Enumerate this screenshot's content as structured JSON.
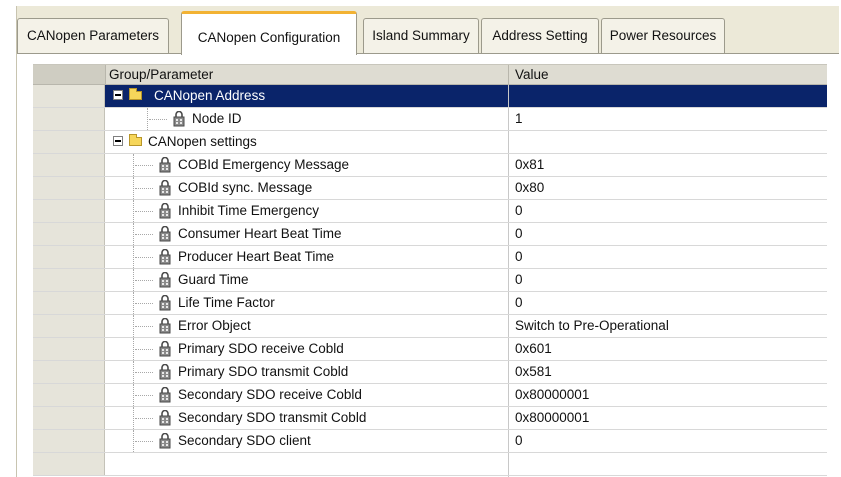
{
  "tabs": [
    {
      "label": "CANopen Parameters",
      "active": false
    },
    {
      "label": "CANopen Configuration",
      "active": true
    },
    {
      "label": "Island Summary",
      "active": false
    },
    {
      "label": "Address Setting",
      "active": false
    },
    {
      "label": "Power Resources",
      "active": false
    }
  ],
  "table": {
    "headers": {
      "param": "Group/Parameter",
      "value": "Value"
    },
    "groups": [
      {
        "label": "CANopen Address",
        "selected": true,
        "icon": "folder-icon",
        "params": [
          {
            "label": "Node ID",
            "value": "1"
          }
        ]
      },
      {
        "label": "CANopen settings",
        "selected": false,
        "icon": "folder-icon",
        "params": [
          {
            "label": "COBId Emergency Message",
            "value": "0x81"
          },
          {
            "label": "COBId sync. Message",
            "value": "0x80"
          },
          {
            "label": "Inhibit Time Emergency",
            "value": "0"
          },
          {
            "label": "Consumer Heart Beat Time",
            "value": "0"
          },
          {
            "label": "Producer Heart Beat Time",
            "value": "0"
          },
          {
            "label": "Guard Time",
            "value": "0"
          },
          {
            "label": "Life Time Factor",
            "value": "0"
          },
          {
            "label": "Error Object",
            "value": "Switch to Pre-Operational"
          },
          {
            "label": "Primary SDO receive Cobld",
            "value": "0x601"
          },
          {
            "label": "Primary SDO transmit Cobld",
            "value": "0x581"
          },
          {
            "label": "Secondary SDO receive Cobld",
            "value": "0x80000001"
          },
          {
            "label": "Secondary SDO transmit Cobld",
            "value": "0x80000001"
          },
          {
            "label": "Secondary SDO client",
            "value": "0"
          }
        ]
      }
    ]
  },
  "colors": {
    "selection": "#0a246a",
    "active_tab_accent": "#f2b233",
    "folder": "#f6d65a"
  },
  "icons": {
    "param": "lock-icon",
    "expander": "collapse-icon",
    "group": "folder-icon"
  }
}
